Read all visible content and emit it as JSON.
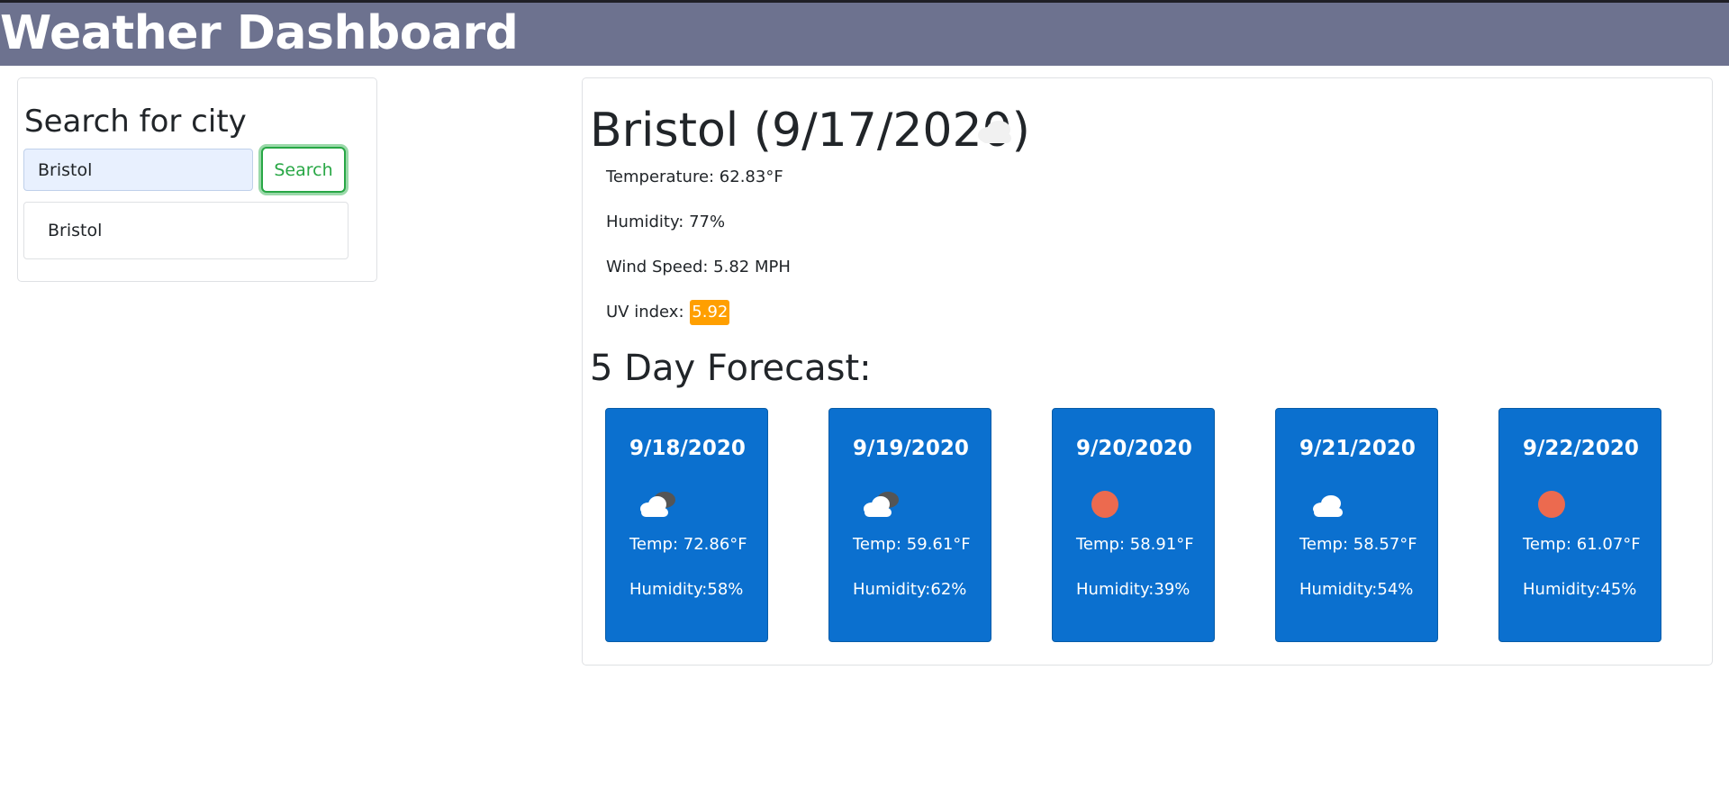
{
  "app": {
    "title": "Weather Dashboard",
    "header_color": "#6d728f"
  },
  "search": {
    "heading": "Search for city",
    "input_value": "Bristol",
    "button_label": "Search",
    "history": [
      "Bristol"
    ]
  },
  "current": {
    "title": "Bristol (9/17/2020)",
    "icon": "cloud-icon",
    "temperature": "Temperature: 62.83°F",
    "humidity": "Humidity: 77%",
    "wind_speed": "Wind Speed: 5.82 MPH",
    "uv_label": "UV index:",
    "uv_value": "5.92",
    "uv_color": "#ff9f00"
  },
  "forecast": {
    "heading": "5 Day Forecast:",
    "card_color": "#0b70cf",
    "days": [
      {
        "date": "9/18/2020",
        "icon": "partly-cloudy-icon",
        "temp": "Temp: 72.86°F",
        "humidity": "Humidity:58%"
      },
      {
        "date": "9/19/2020",
        "icon": "partly-cloudy-icon",
        "temp": "Temp: 59.61°F",
        "humidity": "Humidity:62%"
      },
      {
        "date": "9/20/2020",
        "icon": "sun-icon",
        "temp": "Temp: 58.91°F",
        "humidity": "Humidity:39%"
      },
      {
        "date": "9/21/2020",
        "icon": "cloud-icon",
        "temp": "Temp: 58.57°F",
        "humidity": "Humidity:54%"
      },
      {
        "date": "9/22/2020",
        "icon": "sun-icon",
        "temp": "Temp: 61.07°F",
        "humidity": "Humidity:45%"
      }
    ]
  }
}
